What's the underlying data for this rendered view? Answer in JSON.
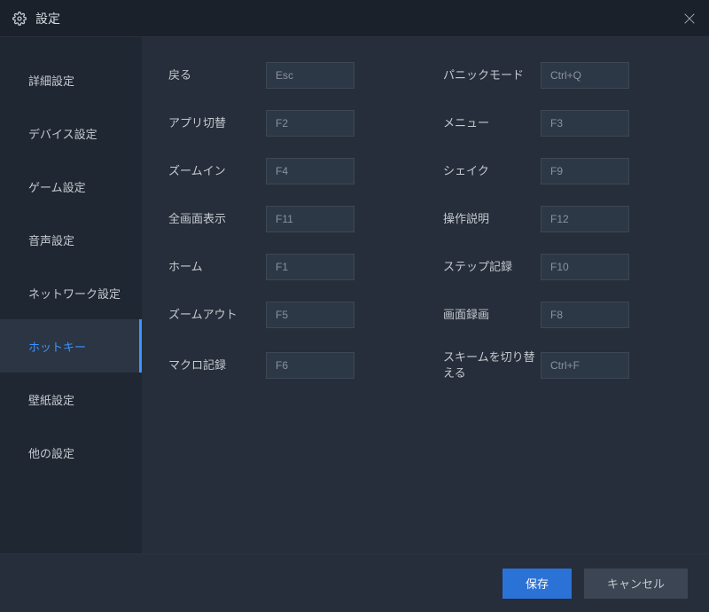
{
  "window": {
    "title": "設定"
  },
  "sidebar": {
    "items": [
      {
        "label": "詳細設定"
      },
      {
        "label": "デバイス設定"
      },
      {
        "label": "ゲーム設定"
      },
      {
        "label": "音声設定"
      },
      {
        "label": "ネットワーク設定"
      },
      {
        "label": "ホットキー"
      },
      {
        "label": "壁紙設定"
      },
      {
        "label": "他の設定"
      }
    ],
    "activeIndex": 5
  },
  "hotkeys": {
    "left": [
      {
        "label": "戻る",
        "value": "Esc"
      },
      {
        "label": "アプリ切替",
        "value": "F2"
      },
      {
        "label": "ズームイン",
        "value": "F4"
      },
      {
        "label": "全画面表示",
        "value": "F11"
      },
      {
        "label": "ホーム",
        "value": "F1"
      },
      {
        "label": "ズームアウト",
        "value": "F5"
      },
      {
        "label": "マクロ記録",
        "value": "F6"
      }
    ],
    "right": [
      {
        "label": "パニックモード",
        "value": "Ctrl+Q"
      },
      {
        "label": "メニュー",
        "value": "F3"
      },
      {
        "label": "シェイク",
        "value": "F9"
      },
      {
        "label": "操作説明",
        "value": "F12"
      },
      {
        "label": "ステップ記録",
        "value": "F10"
      },
      {
        "label": "画面録画",
        "value": "F8"
      },
      {
        "label": "スキームを切り替える",
        "value": "Ctrl+F"
      }
    ]
  },
  "footer": {
    "save": "保存",
    "cancel": "キャンセル"
  }
}
